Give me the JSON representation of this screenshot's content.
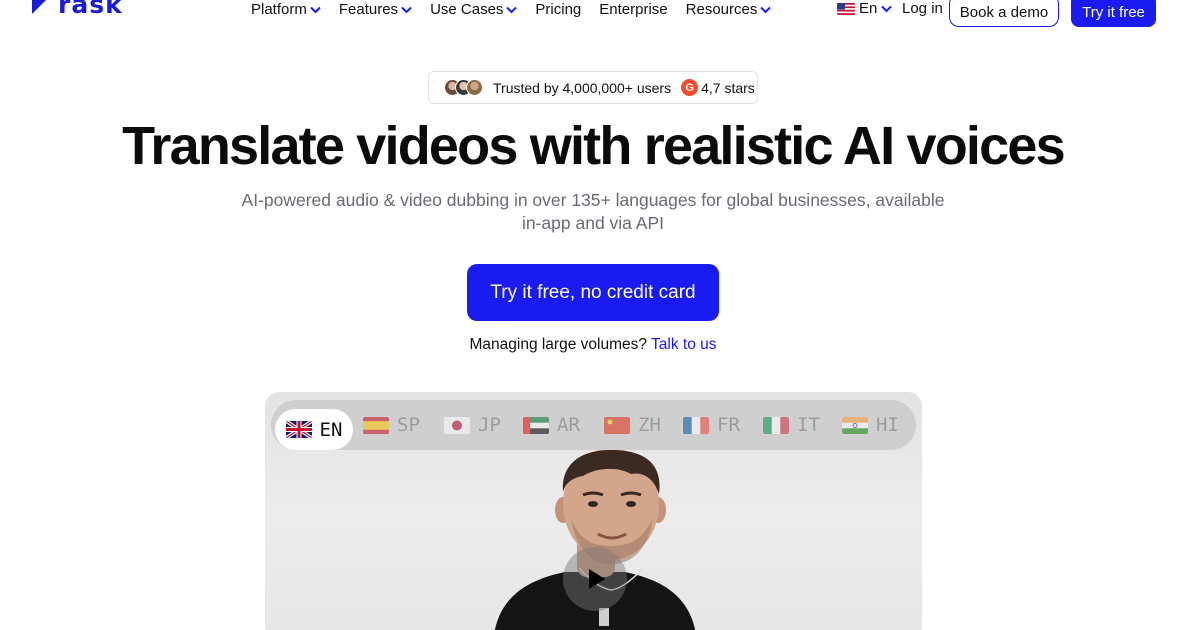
{
  "brand": {
    "name": "rask",
    "accent": "#1a1bf0"
  },
  "nav": {
    "items": [
      {
        "label": "Platform",
        "dropdown": true
      },
      {
        "label": "Features",
        "dropdown": true
      },
      {
        "label": "Use Cases",
        "dropdown": true
      },
      {
        "label": "Pricing",
        "dropdown": false
      },
      {
        "label": "Enterprise",
        "dropdown": false
      },
      {
        "label": "Resources",
        "dropdown": true
      }
    ],
    "language": "En",
    "login": "Log in",
    "book_demo": "Book a demo",
    "try_free": "Try it free"
  },
  "trust": {
    "users_text": "Trusted by 4,000,000+ users",
    "rating_text": "4,7 stars"
  },
  "hero": {
    "headline": "Translate videos with realistic AI voices",
    "subheadline": "AI-powered audio & video dubbing in over 135+ languages for global businesses, available in-app and via API",
    "cta": "Try it free, no credit card",
    "volumes_text": "Managing large volumes?",
    "talk_link": "Talk to us"
  },
  "video": {
    "languages": [
      {
        "code": "EN",
        "flag": "uk-flag",
        "active": true
      },
      {
        "code": "SP",
        "flag": "spain-flag",
        "active": false
      },
      {
        "code": "JP",
        "flag": "japan-flag",
        "active": false
      },
      {
        "code": "AR",
        "flag": "uae-flag",
        "active": false
      },
      {
        "code": "ZH",
        "flag": "china-flag",
        "active": false
      },
      {
        "code": "FR",
        "flag": "france-flag",
        "active": false
      },
      {
        "code": "IT",
        "flag": "italy-flag",
        "active": false
      },
      {
        "code": "HI",
        "flag": "india-flag",
        "active": false
      }
    ],
    "play_icon": "play-icon"
  }
}
